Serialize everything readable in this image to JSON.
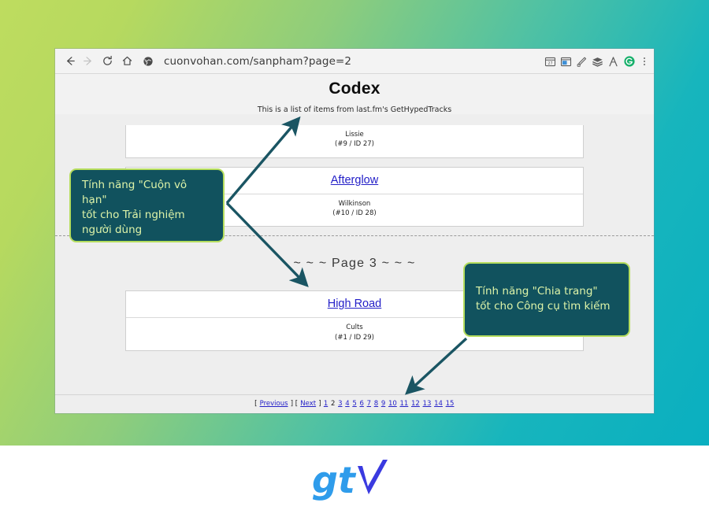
{
  "browser": {
    "url": "cuonvohan.com/sanpham?page=2",
    "nav": {
      "back_icon": "back-arrow-icon",
      "forward_icon": "forward-arrow-icon",
      "reload_icon": "reload-icon",
      "home_icon": "home-icon",
      "site_icon": "globe-icon"
    },
    "extensions": [
      {
        "name": "calendar-extension-icon"
      },
      {
        "name": "window-extension-icon"
      },
      {
        "name": "pen-extension-icon"
      },
      {
        "name": "stack-extension-icon"
      },
      {
        "name": "compass-extension-icon"
      },
      {
        "name": "profile-extension-icon"
      }
    ],
    "menu_icon": "three-dots-menu-icon"
  },
  "page": {
    "title": "Codex",
    "subtitle": "This is a list of items from last.fm's GetHypedTracks",
    "page_marker": "~ ~ ~ Page 3 ~ ~ ~",
    "items": [
      {
        "track": "",
        "artist": "Lissie",
        "meta": "(#9 / ID 27)"
      },
      {
        "track": "Afterglow",
        "artist": "Wilkinson",
        "meta": "(#10 / ID 28)"
      },
      {
        "track": "High Road",
        "artist": "Cults",
        "meta": "(#1 / ID 29)"
      }
    ],
    "pagination": {
      "open_bracket": "[",
      "previous": "Previous",
      "close_bracket": "]",
      "next": "Next",
      "pages": [
        "1",
        "2",
        "3",
        "4",
        "5",
        "6",
        "7",
        "8",
        "9",
        "10",
        "11",
        "12",
        "13",
        "14",
        "15"
      ],
      "current_page": "2"
    }
  },
  "callouts": {
    "scroll": {
      "line1": "Tính năng \"Cuộn vô hạn\"",
      "line2": "tốt cho Trải nghiệm",
      "line3": "người dùng"
    },
    "pagination": {
      "line1": "Tính năng \"Chia trang\"",
      "line2": "tốt cho Công cụ tìm kiếm"
    }
  },
  "branding": {
    "logo_text": "gtv",
    "logo_primary_color": "#2f9ceb",
    "logo_accent_color": "#3a3ae0"
  },
  "theme": {
    "gradient_start": "#bedc5f",
    "gradient_end": "#0aafc0",
    "callout_bg": "#11525e",
    "callout_border": "#b5dd5d",
    "callout_text": "#ddf3a8",
    "link_color": "#2420c8"
  }
}
